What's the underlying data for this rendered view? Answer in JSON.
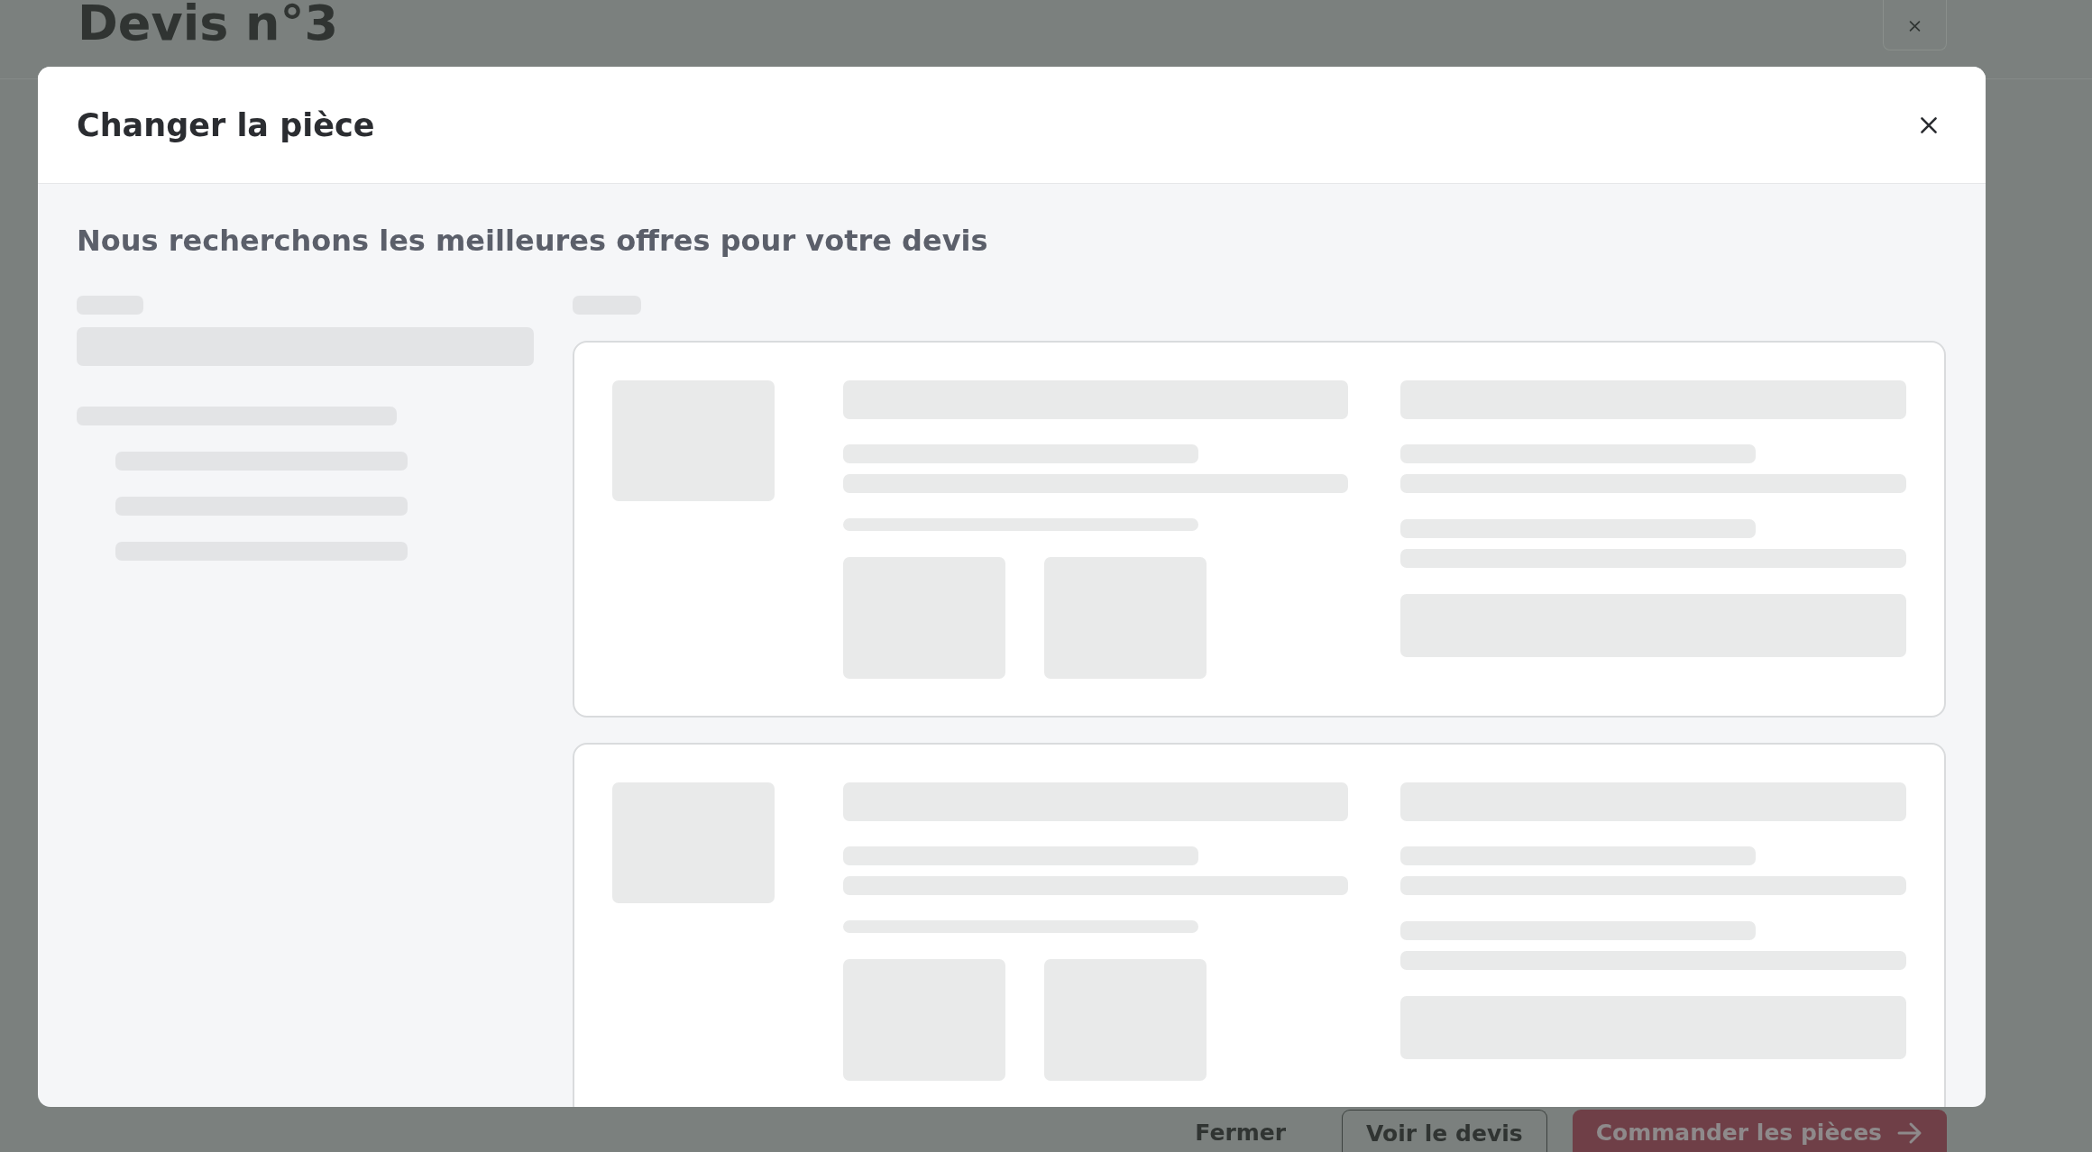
{
  "page": {
    "title": "Devis n°3"
  },
  "footer": {
    "buttons": [
      {
        "label": "Fermer",
        "kind": "text"
      },
      {
        "label": "Voir le devis",
        "kind": "outline"
      },
      {
        "label": "Commander les pièces",
        "kind": "primary"
      }
    ]
  },
  "modal": {
    "title": "Changer la pièce",
    "subtitle": "Nous recherchons les meilleures offres pour votre devis",
    "result_cards": [
      {
        "kind": "skeleton"
      },
      {
        "kind": "skeleton"
      }
    ]
  }
}
